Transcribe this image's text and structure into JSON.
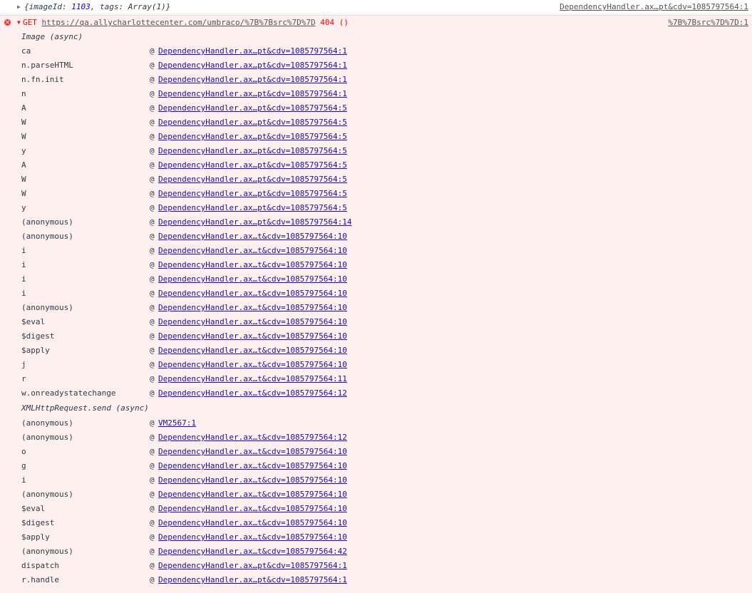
{
  "log_row": {
    "expander": "▶",
    "preview_open": "{",
    "key1": "imageId",
    "val1": "1103",
    "key2": "tags",
    "val2": "Array(1)",
    "preview_close": "}",
    "source": "DependencyHandler.ax…pt&cdv=1085797564:1"
  },
  "error": {
    "icon": "✕",
    "expander": "▼",
    "method": "GET",
    "url": "https://qa.allycharlottecenter.com/umbraco/%7B%7Bsrc%7D%7D",
    "status": "404 ()",
    "source": "%7B%7Bsrc%7D%7D:1"
  },
  "stack": {
    "async_label_1": "Image (async)",
    "frames_1": [
      {
        "fn": "ca",
        "at": "@",
        "link": "DependencyHandler.ax…pt&cdv=1085797564:1"
      },
      {
        "fn": "n.parseHTML",
        "at": "@",
        "link": "DependencyHandler.ax…pt&cdv=1085797564:1"
      },
      {
        "fn": "n.fn.init",
        "at": "@",
        "link": "DependencyHandler.ax…pt&cdv=1085797564:1"
      },
      {
        "fn": "n",
        "at": "@",
        "link": "DependencyHandler.ax…pt&cdv=1085797564:1"
      },
      {
        "fn": "A",
        "at": "@",
        "link": "DependencyHandler.ax…pt&cdv=1085797564:5"
      },
      {
        "fn": "W",
        "at": "@",
        "link": "DependencyHandler.ax…pt&cdv=1085797564:5"
      },
      {
        "fn": "W",
        "at": "@",
        "link": "DependencyHandler.ax…pt&cdv=1085797564:5"
      },
      {
        "fn": "y",
        "at": "@",
        "link": "DependencyHandler.ax…pt&cdv=1085797564:5"
      },
      {
        "fn": "A",
        "at": "@",
        "link": "DependencyHandler.ax…pt&cdv=1085797564:5"
      },
      {
        "fn": "W",
        "at": "@",
        "link": "DependencyHandler.ax…pt&cdv=1085797564:5"
      },
      {
        "fn": "W",
        "at": "@",
        "link": "DependencyHandler.ax…pt&cdv=1085797564:5"
      },
      {
        "fn": "y",
        "at": "@",
        "link": "DependencyHandler.ax…pt&cdv=1085797564:5"
      },
      {
        "fn": "(anonymous)",
        "at": "@",
        "link": "DependencyHandler.ax…pt&cdv=1085797564:14"
      },
      {
        "fn": "(anonymous)",
        "at": "@",
        "link": "DependencyHandler.ax…t&cdv=1085797564:10"
      },
      {
        "fn": "i",
        "at": "@",
        "link": "DependencyHandler.ax…t&cdv=1085797564:10"
      },
      {
        "fn": "i",
        "at": "@",
        "link": "DependencyHandler.ax…t&cdv=1085797564:10"
      },
      {
        "fn": "i",
        "at": "@",
        "link": "DependencyHandler.ax…t&cdv=1085797564:10"
      },
      {
        "fn": "i",
        "at": "@",
        "link": "DependencyHandler.ax…t&cdv=1085797564:10"
      },
      {
        "fn": "(anonymous)",
        "at": "@",
        "link": "DependencyHandler.ax…t&cdv=1085797564:10"
      },
      {
        "fn": "$eval",
        "at": "@",
        "link": "DependencyHandler.ax…t&cdv=1085797564:10"
      },
      {
        "fn": "$digest",
        "at": "@",
        "link": "DependencyHandler.ax…t&cdv=1085797564:10"
      },
      {
        "fn": "$apply",
        "at": "@",
        "link": "DependencyHandler.ax…t&cdv=1085797564:10"
      },
      {
        "fn": "j",
        "at": "@",
        "link": "DependencyHandler.ax…t&cdv=1085797564:10"
      },
      {
        "fn": "r",
        "at": "@",
        "link": "DependencyHandler.ax…t&cdv=1085797564:11"
      },
      {
        "fn": "w.onreadystatechange",
        "at": "@",
        "link": "DependencyHandler.ax…t&cdv=1085797564:12"
      }
    ],
    "async_label_2": "XMLHttpRequest.send (async)",
    "frames_2": [
      {
        "fn": "(anonymous)",
        "at": "@",
        "link": "VM2567:1"
      },
      {
        "fn": "(anonymous)",
        "at": "@",
        "link": "DependencyHandler.ax…t&cdv=1085797564:12"
      },
      {
        "fn": "o",
        "at": "@",
        "link": "DependencyHandler.ax…t&cdv=1085797564:10"
      },
      {
        "fn": "g",
        "at": "@",
        "link": "DependencyHandler.ax…t&cdv=1085797564:10"
      },
      {
        "fn": "i",
        "at": "@",
        "link": "DependencyHandler.ax…t&cdv=1085797564:10"
      },
      {
        "fn": "(anonymous)",
        "at": "@",
        "link": "DependencyHandler.ax…t&cdv=1085797564:10"
      },
      {
        "fn": "$eval",
        "at": "@",
        "link": "DependencyHandler.ax…t&cdv=1085797564:10"
      },
      {
        "fn": "$digest",
        "at": "@",
        "link": "DependencyHandler.ax…t&cdv=1085797564:10"
      },
      {
        "fn": "$apply",
        "at": "@",
        "link": "DependencyHandler.ax…t&cdv=1085797564:10"
      },
      {
        "fn": "(anonymous)",
        "at": "@",
        "link": "DependencyHandler.ax…t&cdv=1085797564:42"
      },
      {
        "fn": "dispatch",
        "at": "@",
        "link": "DependencyHandler.ax…pt&cdv=1085797564:1"
      },
      {
        "fn": "r.handle",
        "at": "@",
        "link": "DependencyHandler.ax…pt&cdv=1085797564:1"
      }
    ]
  },
  "colors": {
    "error_bg": "#fff0f0",
    "error_text": "#ff0000",
    "link": "#1a0dab",
    "number": "#1c00cf"
  }
}
